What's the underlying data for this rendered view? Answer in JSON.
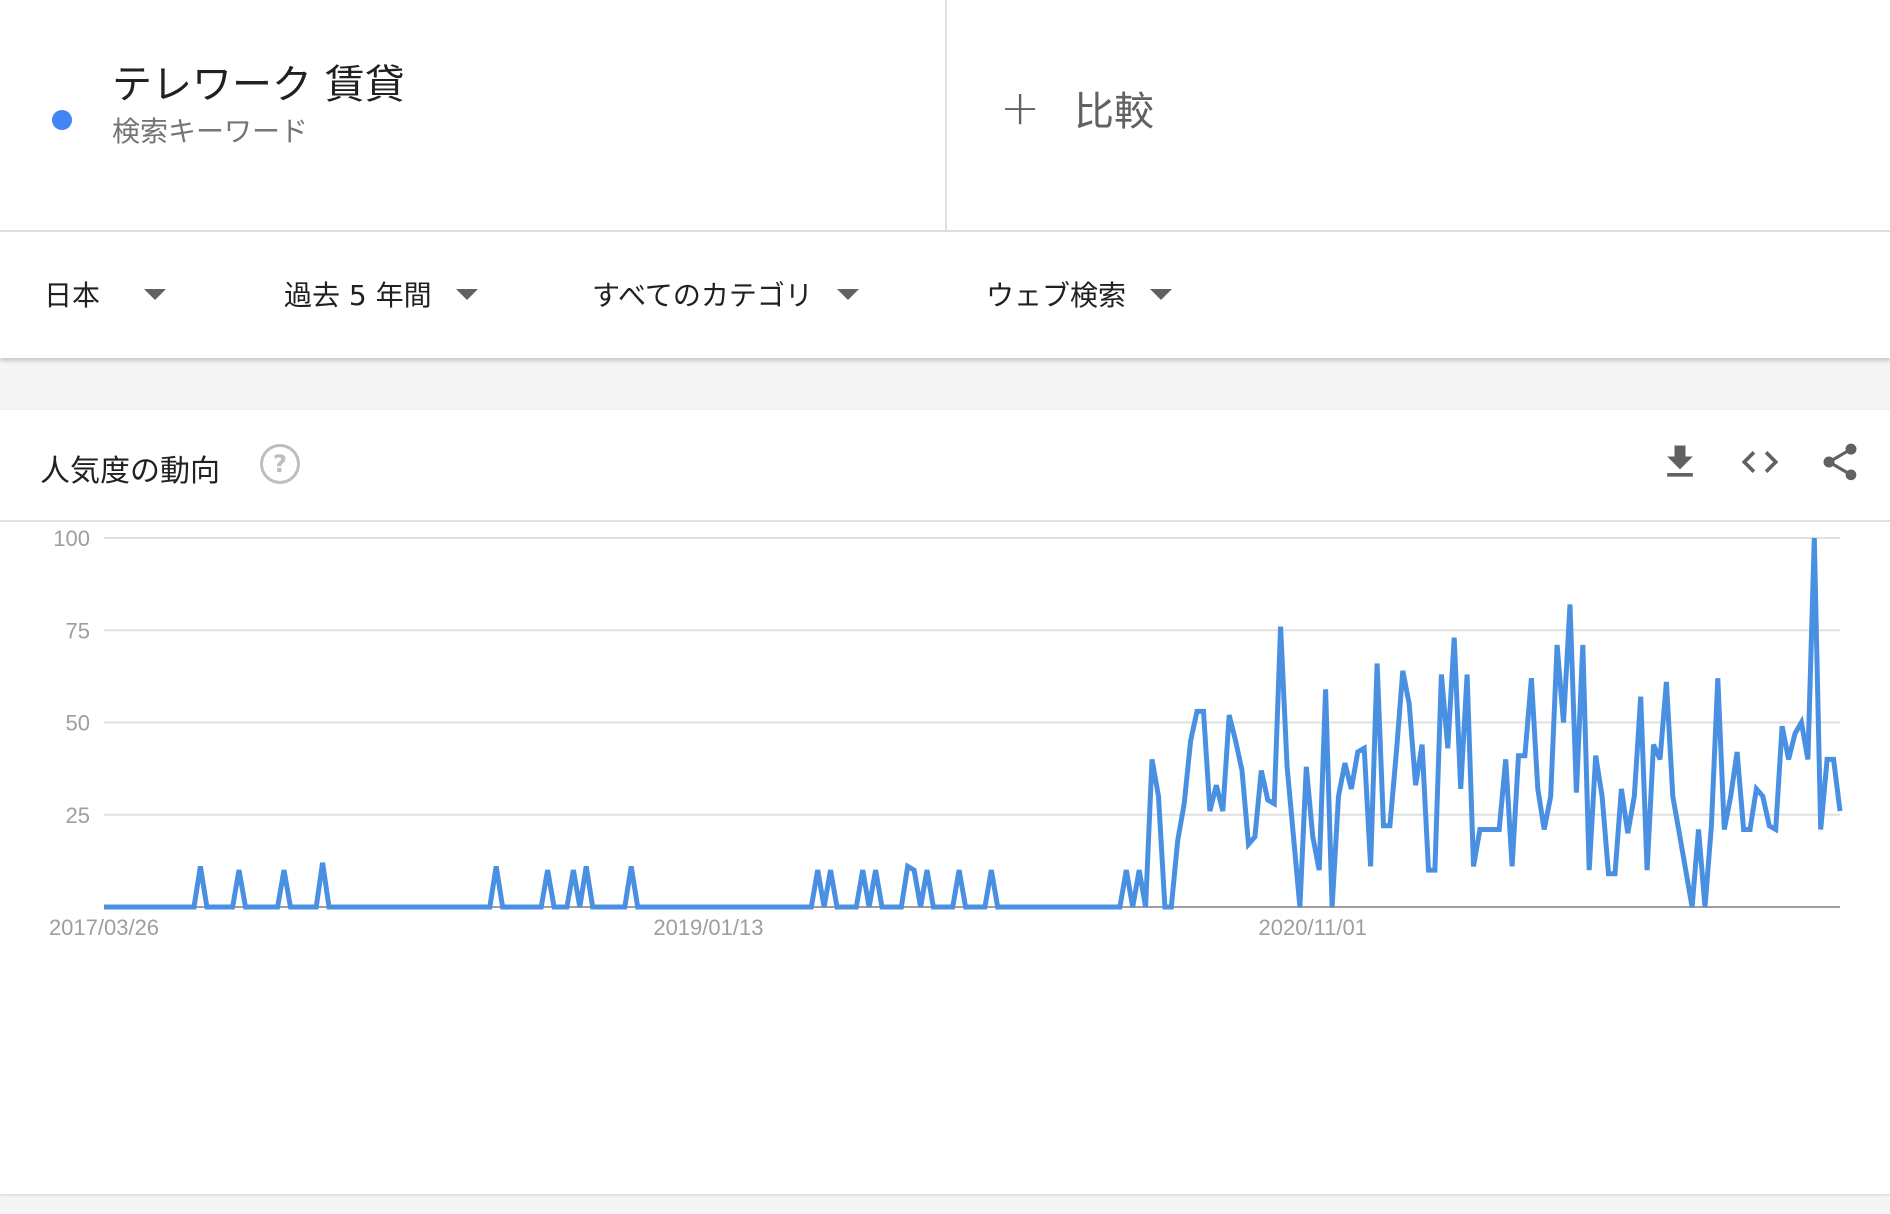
{
  "search_term": {
    "title": "テレワーク 賃貸",
    "subtitle": "検索キーワード",
    "color": "#4285f4"
  },
  "compare": {
    "icon": "plus-icon",
    "label": "比較"
  },
  "filters": [
    {
      "label": "日本"
    },
    {
      "label": "過去 5 年間"
    },
    {
      "label": "すべてのカテゴリ"
    },
    {
      "label": "ウェブ検索"
    }
  ],
  "trend_panel": {
    "title": "人気度の動向",
    "help_icon": "question-circle-icon",
    "help_glyph": "?",
    "actions": [
      "download-icon",
      "embed-code-icon",
      "share-icon"
    ]
  },
  "chart_data": {
    "type": "line",
    "color": "#4a90e2",
    "ylim": [
      0,
      100
    ],
    "yticks": [
      25,
      50,
      75,
      100
    ],
    "xtick_labels": [
      "2017/03/26",
      "2019/01/13",
      "2020/11/01"
    ],
    "xtick_index": [
      0,
      94,
      188
    ],
    "grid": true,
    "series": [
      {
        "values": [
          0,
          0,
          0,
          0,
          0,
          0,
          0,
          0,
          0,
          0,
          0,
          0,
          0,
          0,
          0,
          11,
          0,
          0,
          0,
          0,
          0,
          10,
          0,
          0,
          0,
          0,
          0,
          0,
          10,
          0,
          0,
          0,
          0,
          0,
          12,
          0,
          0,
          0,
          0,
          0,
          0,
          0,
          0,
          0,
          0,
          0,
          0,
          0,
          0,
          0,
          0,
          0,
          0,
          0,
          0,
          0,
          0,
          0,
          0,
          0,
          0,
          11,
          0,
          0,
          0,
          0,
          0,
          0,
          0,
          10,
          0,
          0,
          0,
          10,
          0,
          11,
          0,
          0,
          0,
          0,
          0,
          0,
          11,
          0,
          0,
          0,
          0,
          0,
          0,
          0,
          0,
          0,
          0,
          0,
          0,
          0,
          0,
          0,
          0,
          0,
          0,
          0,
          0,
          0,
          0,
          0,
          0,
          0,
          0,
          0,
          0,
          10,
          0,
          10,
          0,
          0,
          0,
          0,
          10,
          0,
          10,
          0,
          0,
          0,
          0,
          11,
          10,
          0,
          10,
          0,
          0,
          0,
          0,
          10,
          0,
          0,
          0,
          0,
          10,
          0,
          0,
          0,
          0,
          0,
          0,
          0,
          0,
          0,
          0,
          0,
          0,
          0,
          0,
          0,
          0,
          0,
          0,
          0,
          0,
          10,
          0,
          10,
          0,
          40,
          30,
          0,
          0,
          18,
          28,
          45,
          53,
          53,
          26,
          33,
          26,
          52,
          45,
          37,
          17,
          19,
          37,
          29,
          28,
          76,
          38,
          19,
          0,
          38,
          19,
          10,
          59,
          0,
          30,
          39,
          32,
          42,
          43,
          11,
          66,
          22,
          22,
          42,
          64,
          55,
          33,
          44,
          10,
          10,
          63,
          43,
          73,
          32,
          63,
          11,
          21,
          21,
          21,
          21,
          40,
          11,
          41,
          41,
          62,
          32,
          21,
          30,
          71,
          50,
          82,
          31,
          71,
          10,
          41,
          30,
          9,
          9,
          32,
          20,
          30,
          57,
          10,
          44,
          40,
          61,
          30,
          20,
          10,
          0,
          21,
          0,
          22,
          62,
          21,
          30,
          42,
          21,
          21,
          32,
          30,
          22,
          21,
          49,
          40,
          47,
          50,
          40,
          100,
          21,
          40,
          40,
          26
        ]
      }
    ]
  }
}
